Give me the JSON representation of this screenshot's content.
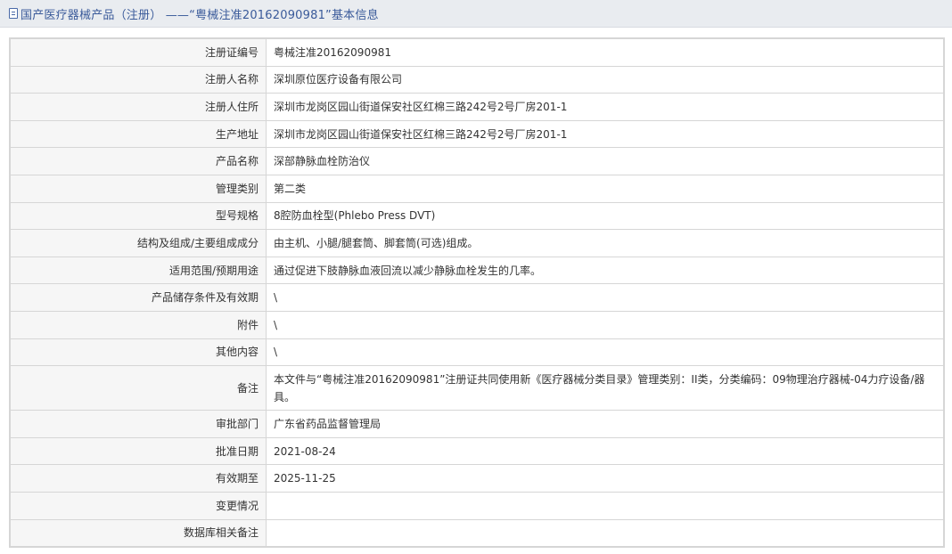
{
  "header": {
    "title": "国产医疗器械产品（注册） ——“粤械注准20162090981”基本信息",
    "icon": "document-icon"
  },
  "rows": [
    {
      "label": "注册证编号",
      "value": "粤械注准20162090981"
    },
    {
      "label": "注册人名称",
      "value": "深圳原位医疗设备有限公司"
    },
    {
      "label": "注册人住所",
      "value": "深圳市龙岗区园山街道保安社区红棉三路242号2号厂房201-1"
    },
    {
      "label": "生产地址",
      "value": "深圳市龙岗区园山街道保安社区红棉三路242号2号厂房201-1"
    },
    {
      "label": "产品名称",
      "value": "深部静脉血栓防治仪"
    },
    {
      "label": "管理类别",
      "value": "第二类"
    },
    {
      "label": "型号规格",
      "value": "8腔防血栓型(Phlebo Press DVT)"
    },
    {
      "label": "结构及组成/主要组成成分",
      "value": "由主机、小腿/腿套筒、脚套筒(可选)组成。"
    },
    {
      "label": "适用范围/预期用途",
      "value": "通过促进下肢静脉血液回流以减少静脉血栓发生的几率。"
    },
    {
      "label": "产品储存条件及有效期",
      "value": "\\"
    },
    {
      "label": "附件",
      "value": "\\"
    },
    {
      "label": "其他内容",
      "value": "\\"
    },
    {
      "label": "备注",
      "value": "本文件与“粤械注准20162090981”注册证共同使用新《医疗器械分类目录》管理类别：II类，分类编码：09物理治疗器械-04力疗设备/器具。"
    },
    {
      "label": "审批部门",
      "value": "广东省药品监督管理局"
    },
    {
      "label": "批准日期",
      "value": "2021-08-24"
    },
    {
      "label": "有效期至",
      "value": "2025-11-25"
    },
    {
      "label": "变更情况",
      "value": ""
    },
    {
      "label": "数据库相关备注",
      "value": ""
    }
  ]
}
